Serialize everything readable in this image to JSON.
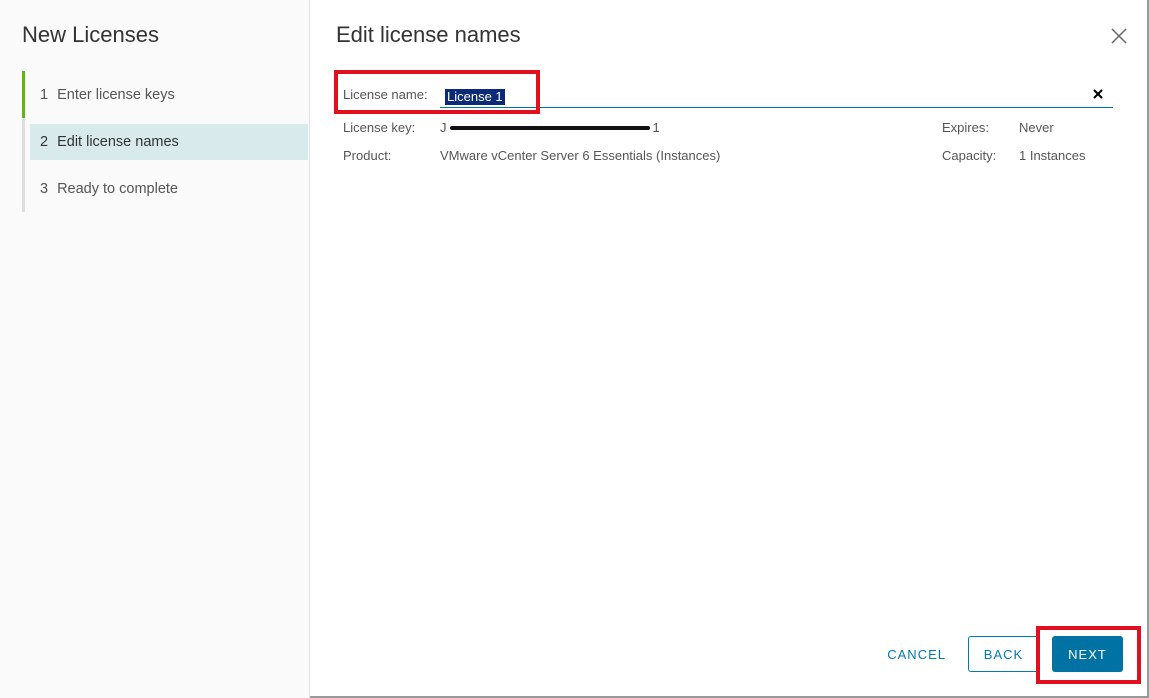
{
  "wizard": {
    "title": "New Licenses",
    "steps": [
      {
        "num": "1",
        "label": "Enter license keys"
      },
      {
        "num": "2",
        "label": "Edit license names"
      },
      {
        "num": "3",
        "label": "Ready to complete"
      }
    ],
    "active_step": 2
  },
  "page": {
    "title": "Edit license names"
  },
  "license": {
    "name_label": "License name:",
    "name_value": "License 1",
    "key_label": "License key:",
    "key_prefix": "J",
    "key_suffix": "1",
    "product_label": "Product:",
    "product_value": "VMware vCenter Server 6 Essentials (Instances)",
    "expires_label": "Expires:",
    "expires_value": "Never",
    "capacity_label": "Capacity:",
    "capacity_value": "1 Instances"
  },
  "footer": {
    "cancel": "CANCEL",
    "back": "BACK",
    "next": "NEXT"
  },
  "colors": {
    "accent": "#0072a3",
    "progress": "#5eb715",
    "annotation": "#e2101e",
    "selection": "#0b2a7a"
  }
}
